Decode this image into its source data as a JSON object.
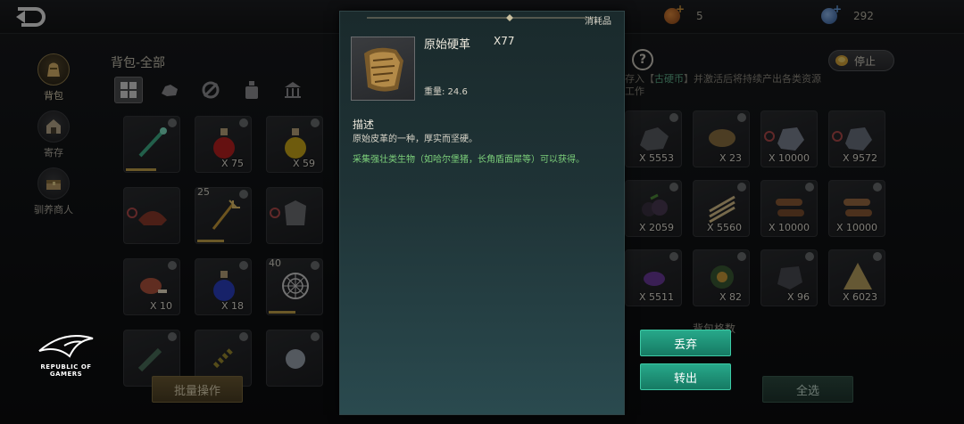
{
  "topbar": {
    "back_icon": "back-arrow-icon",
    "currencies": [
      {
        "icon": "copper-coin-icon",
        "value": "5",
        "color": "#c8712e"
      },
      {
        "icon": "gem-icon",
        "value": "292",
        "color": "#5c8fd6"
      }
    ]
  },
  "sidenav": {
    "items": [
      {
        "label": "背包",
        "icon": "bag-icon",
        "active": true
      },
      {
        "label": "寄存",
        "icon": "storehouse-icon",
        "active": false
      },
      {
        "label": "驯养商人",
        "icon": "merchant-chest-icon",
        "active": false
      }
    ]
  },
  "bag": {
    "title": "背包-全部",
    "category_tabs": [
      {
        "icon": "grid-all-icon",
        "active": true
      },
      {
        "icon": "ore-icon",
        "active": false
      },
      {
        "icon": "equipment-icon",
        "active": false
      },
      {
        "icon": "potion-bottle-icon",
        "active": false
      },
      {
        "icon": "building-icon",
        "active": false
      },
      {
        "icon": "more-icon",
        "active": false
      }
    ],
    "left_items": [
      {
        "qty": "",
        "level": "",
        "art": "green-staff-icon"
      },
      {
        "qty": "X 75",
        "level": "",
        "art": "red-potion-icon"
      },
      {
        "qty": "X 59",
        "level": "",
        "art": "yellow-potion-icon"
      },
      {
        "qty": "",
        "level": "",
        "art": "saddle-icon"
      },
      {
        "qty": "",
        "level": "25",
        "art": "trident-icon"
      },
      {
        "qty": "",
        "level": "",
        "art": "armor-icon"
      },
      {
        "qty": "X 10",
        "level": "",
        "art": "meat-icon"
      },
      {
        "qty": "X 18",
        "level": "",
        "art": "blue-potion-icon"
      },
      {
        "qty": "",
        "level": "40",
        "art": "spiderweb-shield-icon"
      },
      {
        "qty": "",
        "level": "",
        "art": "club-icon"
      },
      {
        "qty": "",
        "level": "",
        "art": "bracelet-icon"
      },
      {
        "qty": "",
        "level": "",
        "art": "fur-icon"
      }
    ],
    "right_items": [
      {
        "qty": "X 5553",
        "art": "ore-chunk-icon"
      },
      {
        "qty": "X 23",
        "art": "hide-icon"
      },
      {
        "qty": "X 10000",
        "art": "stone-icon"
      },
      {
        "qty": "X 9572",
        "art": "iron-ore-icon"
      },
      {
        "qty": "X 2059",
        "art": "berry-icon"
      },
      {
        "qty": "X 5560",
        "art": "fiber-icon"
      },
      {
        "qty": "X 10000",
        "art": "log-icon"
      },
      {
        "qty": "X 10000",
        "art": "log-icon"
      },
      {
        "qty": "X 5511",
        "art": "purple-crystal-icon"
      },
      {
        "qty": "X 82",
        "art": "amulet-icon"
      },
      {
        "qty": "X 96",
        "art": "metal-scrap-icon"
      },
      {
        "qty": "X 6023",
        "art": "straw-icon"
      }
    ],
    "bag_slots_label": "背包格数",
    "batch_button": "批量操作",
    "select_all_button": "全选"
  },
  "right_panel": {
    "help_icon": "?",
    "stop_label": "停止",
    "note_prefix": "存入【",
    "note_highlight": "古硬币",
    "note_suffix": "】并激活后将持续产出各类资源",
    "note_line2": "工作"
  },
  "detail": {
    "tag": "消耗品",
    "item_icon": "raw-hide-leather-icon",
    "name": "原始硬革",
    "count": "X77",
    "weight": "重量: 24.6",
    "desc_header": "描述",
    "description": "原始皮革的一种，厚实而坚硬。",
    "source": "采集强壮类生物（如哈尔堡猪，长角盾面犀等）可以获得。",
    "discard_button": "丢弃",
    "transfer_button": "转出"
  },
  "branding": {
    "logo_icon": "rog-eye-logo-icon",
    "line1": "REPUBLIC OF",
    "line2": "GAMERS"
  }
}
